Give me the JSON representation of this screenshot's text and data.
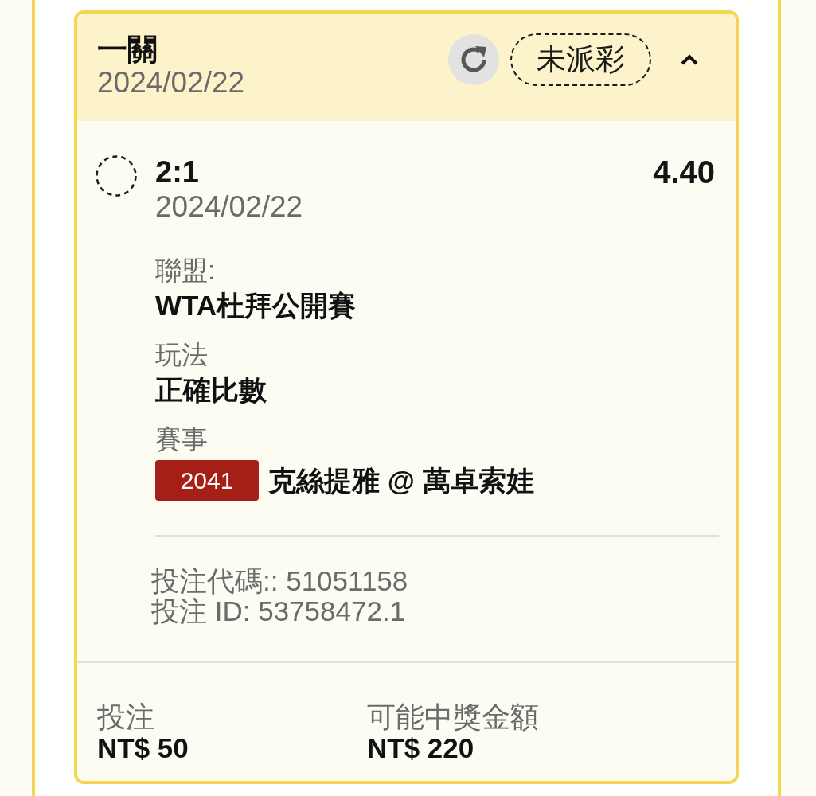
{
  "bet_card": {
    "title": "一關",
    "date": "2024/02/22",
    "status": "未派彩",
    "expanded": true,
    "selection": {
      "pending": true,
      "pick": "2:1",
      "date": "2024/02/22",
      "odds": "4.40",
      "league": {
        "label": "聯盟:",
        "value": "WTA杜拜公開賽"
      },
      "market": {
        "label": "玩法",
        "value": "正確比數"
      },
      "event": {
        "label": "賽事",
        "number": "2041",
        "teams": "克絲提雅 @ 萬卓索娃"
      },
      "bet_code": "投注代碼:: 51051158",
      "bet_id": "投注 ID: 53758472.1"
    },
    "stake": {
      "label": "投注",
      "value": "NT$ 50"
    },
    "potential_payout": {
      "label": "可能中獎金額",
      "value": "NT$ 220"
    }
  }
}
